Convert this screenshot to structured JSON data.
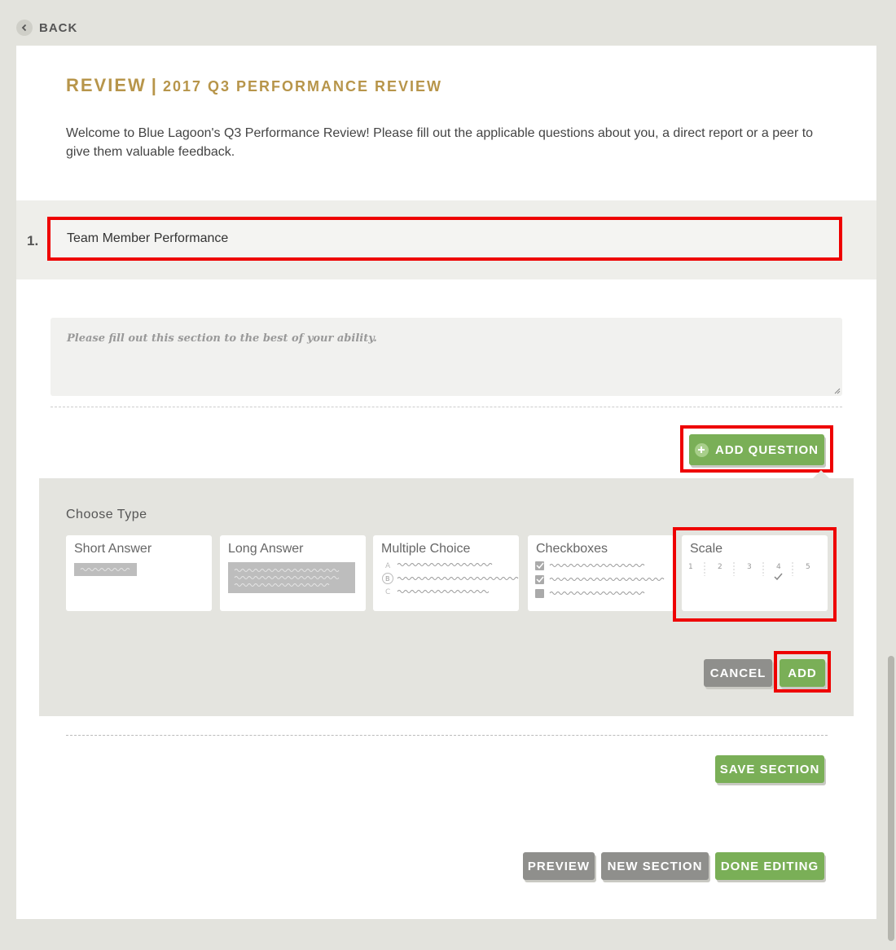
{
  "nav": {
    "back_label": "BACK"
  },
  "header": {
    "title_main": "REVIEW",
    "title_sep": "|",
    "title_sub": "2017 Q3 PERFORMANCE REVIEW",
    "intro": "Welcome to Blue Lagoon's Q3 Performance Review! Please fill out the applicable questions about you, a direct report or a peer to give them valuable feedback."
  },
  "section": {
    "number": "1.",
    "title_value": "Team Member Performance",
    "description_placeholder": "Please fill out this section to the best of your ability."
  },
  "add_question": {
    "label": "ADD QUESTION"
  },
  "chooser": {
    "label": "Choose Type",
    "types": [
      {
        "label": "Short Answer"
      },
      {
        "label": "Long Answer"
      },
      {
        "label": "Multiple Choice",
        "options": [
          "A",
          "B",
          "C"
        ]
      },
      {
        "label": "Checkboxes"
      },
      {
        "label": "Scale",
        "ticks": [
          "1",
          "2",
          "3",
          "4",
          "5"
        ]
      }
    ],
    "cancel_label": "CANCEL",
    "add_label": "ADD"
  },
  "save_section_label": "SAVE SECTION",
  "footer": {
    "preview_label": "PREVIEW",
    "new_section_label": "NEW SECTION",
    "done_label": "DONE EDITING"
  },
  "colors": {
    "accent_gold": "#b7954a",
    "green": "#7aaf57",
    "gray_button": "#8f8f8c",
    "highlight_red": "#ee0000"
  }
}
